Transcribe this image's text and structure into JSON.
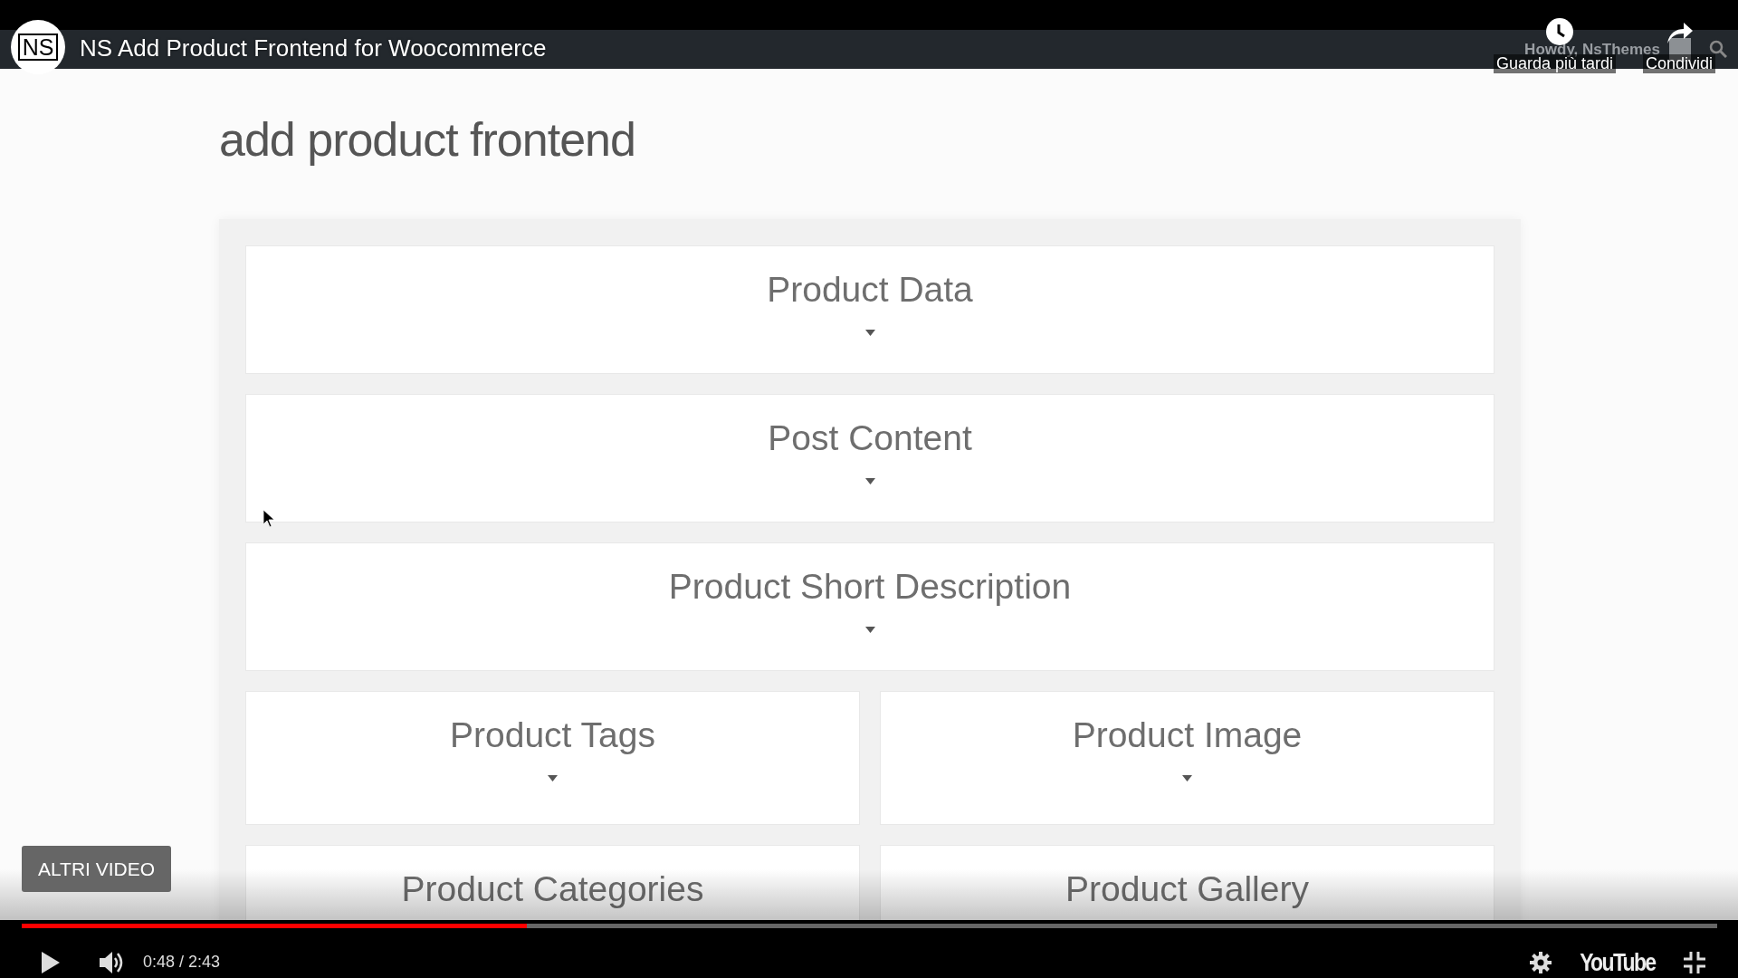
{
  "page": {
    "admin_bar": {
      "greeting": "Howdy, NsThemes"
    },
    "heading": "add product frontend",
    "sections": [
      {
        "label": "Product Data",
        "kind": "full"
      },
      {
        "label": "Post Content",
        "kind": "full"
      },
      {
        "label": "Product Short Description",
        "kind": "full"
      },
      {
        "label": "Product Tags",
        "kind": "half"
      },
      {
        "label": "Product Image",
        "kind": "half"
      },
      {
        "label": "Product Categories",
        "kind": "partial"
      },
      {
        "label": "Product Gallery",
        "kind": "partial"
      }
    ]
  },
  "player": {
    "channel_logo": "NS",
    "title": "NS Add Product Frontend for Woocommerce",
    "watch_later": "Guarda più tardi",
    "share": "Condividi",
    "more_videos": "ALTRI VIDEO",
    "progress": {
      "level": 0.298
    },
    "time": "0:48 / 2:43",
    "brand": "YouTube"
  }
}
